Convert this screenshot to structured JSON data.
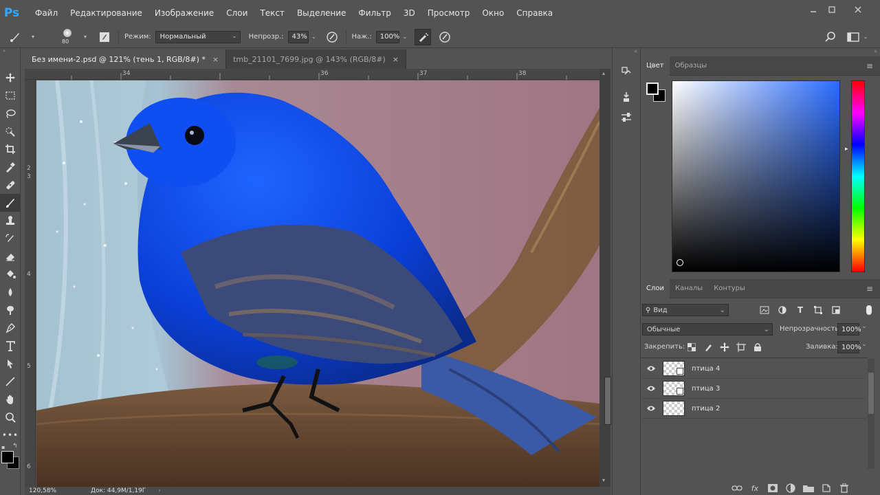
{
  "app": {
    "logo": "Ps"
  },
  "menu": [
    "Файл",
    "Редактирование",
    "Изображение",
    "Слои",
    "Текст",
    "Выделение",
    "Фильтр",
    "3D",
    "Просмотр",
    "Окно",
    "Справка"
  ],
  "options": {
    "brush_size": "80",
    "mode_label": "Режим:",
    "mode_value": "Нормальный",
    "opacity_label": "Непрозр.:",
    "opacity_value": "43%",
    "flow_label": "Наж.:",
    "flow_value": "100%"
  },
  "tabs": [
    {
      "label": "Без имени-2.psd @ 121% (тень 1, RGB/8#) *",
      "close": "×"
    },
    {
      "label": "tmb_21101_7699.jpg @ 143% (RGB/8#)",
      "close": "×"
    }
  ],
  "ruler": {
    "top": [
      "34",
      "36",
      "37",
      "38"
    ],
    "left": [
      "2",
      "3",
      "4",
      "5",
      "6"
    ]
  },
  "status": {
    "zoom": "120,58%",
    "doc": "Док: 44,9M/1,19Г"
  },
  "color_panel": {
    "tabs": [
      "Цвет",
      "Образцы"
    ],
    "base_hue": "#2a6cff"
  },
  "layers_panel": {
    "tabs": [
      "Слои",
      "Каналы",
      "Контуры"
    ],
    "filter_label": "Вид",
    "blend_mode": "Обычные",
    "opacity_label": "Непрозрачность:",
    "opacity_value": "100%",
    "lock_label": "Закрепить:",
    "fill_label": "Заливка:",
    "fill_value": "100%",
    "layers": [
      {
        "name": "птица 4"
      },
      {
        "name": "птица 3"
      },
      {
        "name": "птица 2"
      }
    ]
  }
}
